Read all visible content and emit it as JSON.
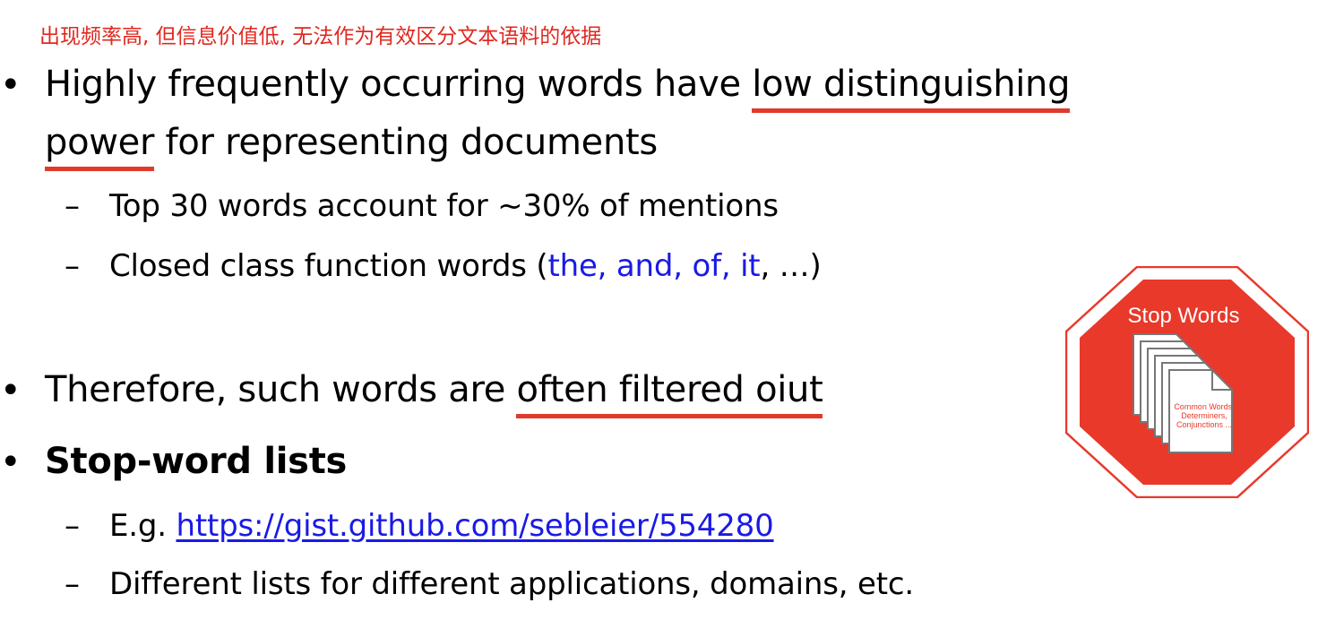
{
  "annotation": "出现频率高, 但信息价值低, 无法作为有效区分文本语料的依据",
  "bullet_glyph": "•",
  "dash_glyph": "–",
  "bullets": {
    "b1": {
      "text_a": "Highly frequently occurring words have ",
      "underlined_a": "low distinguishing",
      "underlined_b": "power",
      "text_b": " for representing documents"
    },
    "sub1": "Top 30 words account for ~30% of mentions",
    "sub2": {
      "prefix": "Closed class function words (",
      "highlight": "the, and, of, it",
      "suffix": ", …)"
    },
    "b2": {
      "text": "Therefore, such words are ",
      "underlined": "often filtered oiut"
    },
    "b3": "Stop-word lists",
    "sub3": {
      "prefix": "E.g. ",
      "link": "https://gist.github.com/sebleier/554280"
    },
    "sub4": "Different lists for different applications, domains, etc."
  },
  "stop_sign": {
    "title": "Stop Words",
    "doc_lines": [
      "Common Words,",
      "Determiners,",
      "Conjunctions ..."
    ],
    "colors": {
      "red": "#e8392b",
      "white": "#ffffff"
    }
  }
}
